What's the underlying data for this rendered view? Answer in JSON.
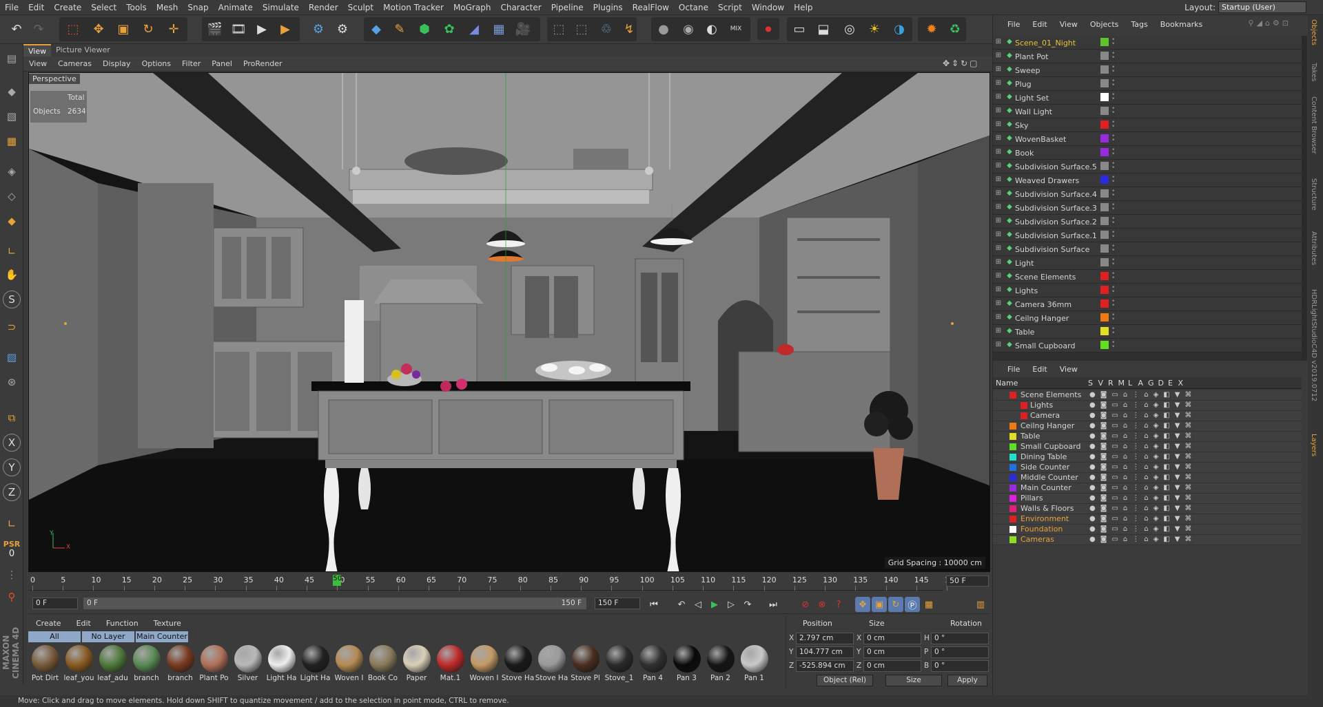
{
  "menubar": {
    "items": [
      "File",
      "Edit",
      "Create",
      "Select",
      "Tools",
      "Mesh",
      "Snap",
      "Animate",
      "Simulate",
      "Render",
      "Sculpt",
      "Motion Tracker",
      "MoGraph",
      "Character",
      "Pipeline",
      "Plugins",
      "RealFlow",
      "Octane",
      "Script",
      "Window",
      "Help"
    ],
    "layout_label": "Layout:",
    "layout_value": "Startup (User)"
  },
  "viewport": {
    "tabs": [
      "View",
      "Picture Viewer"
    ],
    "menu": [
      "View",
      "Cameras",
      "Display",
      "Options",
      "Filter",
      "Panel",
      "ProRender"
    ],
    "camera_label": "Perspective",
    "hud": {
      "total_label": "Total",
      "objects_label": "Objects",
      "objects_value": "2634"
    },
    "grid_spacing": "Grid Spacing : 10000 cm",
    "axes": {
      "y": "Y",
      "x": "X"
    }
  },
  "left_tools": {
    "psr_label": "PSR",
    "psr_value": "0",
    "x_label": "X",
    "y_label": "Y",
    "z_label": "Z",
    "s_label": "S"
  },
  "timeline": {
    "ticks": [
      "0",
      "5",
      "10",
      "15",
      "20",
      "25",
      "30",
      "35",
      "40",
      "45",
      "50",
      "55",
      "60",
      "65",
      "70",
      "75",
      "80",
      "85",
      "90",
      "95",
      "100",
      "105",
      "110",
      "115",
      "120",
      "125",
      "130",
      "135",
      "140",
      "145",
      "150"
    ],
    "current": "50",
    "end_frame": "50 F",
    "start_field": "0 F",
    "range_start": "0 F",
    "range_end": "150 F",
    "max_field": "150 F"
  },
  "materials": {
    "menu": [
      "Create",
      "Edit",
      "Function",
      "Texture"
    ],
    "filters": [
      "All",
      "No Layer",
      "Main Counter"
    ],
    "items": [
      {
        "name": "Pot Dirt",
        "color": "#7a5a3a"
      },
      {
        "name": "leaf_you",
        "color": "#8a5a22"
      },
      {
        "name": "leaf_adu",
        "color": "#4f7a3a"
      },
      {
        "name": "branch",
        "color": "#5a8a55"
      },
      {
        "name": "branch",
        "color": "#7a3a20"
      },
      {
        "name": "Plant Po",
        "color": "#b0705a"
      },
      {
        "name": "Silver",
        "color": "#b8b8b8"
      },
      {
        "name": "Light Ha",
        "color": "#eeeeee"
      },
      {
        "name": "Light Ha",
        "color": "#222222"
      },
      {
        "name": "Woven I",
        "color": "#b58a55"
      },
      {
        "name": "Book Co",
        "color": "#8a7a5a"
      },
      {
        "name": "Paper",
        "color": "#d8d0b8"
      },
      {
        "name": "Mat.1",
        "color": "#c02a2a"
      },
      {
        "name": "Woven I",
        "color": "#c49a65"
      },
      {
        "name": "Stove Ha",
        "color": "#1a1a1a"
      },
      {
        "name": "Stove Ha",
        "color": "#9a9a9a"
      },
      {
        "name": "Stove Pl",
        "color": "#4a2e20"
      },
      {
        "name": "Stove_1",
        "color": "#2a2a2a"
      },
      {
        "name": "Pan 4",
        "color": "#303030"
      },
      {
        "name": "Pan 3",
        "color": "#0a0a0a"
      },
      {
        "name": "Pan 2",
        "color": "#151515"
      },
      {
        "name": "Pan 1",
        "color": "#c8c8c8"
      }
    ]
  },
  "coords": {
    "headers": [
      "Position",
      "Size",
      "Rotation"
    ],
    "rows": [
      {
        "axis": "X",
        "pos": "2.797 cm",
        "size_axis": "X",
        "size": "0 cm",
        "rot_axis": "H",
        "rot": "0 °"
      },
      {
        "axis": "Y",
        "pos": "104.777 cm",
        "size_axis": "Y",
        "size": "0 cm",
        "rot_axis": "P",
        "rot": "0 °"
      },
      {
        "axis": "Z",
        "pos": "-525.894 cm",
        "size_axis": "Z",
        "size": "0 cm",
        "rot_axis": "B",
        "rot": "0 °"
      }
    ],
    "mode": "Object (Rel)",
    "size_mode": "Size",
    "apply": "Apply"
  },
  "status": "Move: Click and drag to move elements. Hold down SHIFT to quantize movement / add to the selection in point mode, CTRL to remove.",
  "objects": {
    "menu": [
      "File",
      "Edit",
      "View",
      "Objects",
      "Tags",
      "Bookmarks"
    ],
    "rows": [
      {
        "name": "Scene_01_Night",
        "color": "#5ec62a",
        "highlight": true
      },
      {
        "name": "Plant Pot",
        "color": "#888"
      },
      {
        "name": "Sweep",
        "color": "#888"
      },
      {
        "name": "Plug",
        "color": "#888"
      },
      {
        "name": "Light Set",
        "color": "#ffffff"
      },
      {
        "name": "Wall Light",
        "color": "#888"
      },
      {
        "name": "Sky",
        "color": "#e02020"
      },
      {
        "name": "WovenBasket",
        "color": "#9a2ae0"
      },
      {
        "name": "Book",
        "color": "#9a2ae0"
      },
      {
        "name": "Subdivision Surface.5",
        "color": "#888"
      },
      {
        "name": "Weaved Drawers",
        "color": "#2a2ae0"
      },
      {
        "name": "Subdivision Surface.4",
        "color": "#888"
      },
      {
        "name": "Subdivision Surface.3",
        "color": "#888"
      },
      {
        "name": "Subdivision Surface.2",
        "color": "#888"
      },
      {
        "name": "Subdivision Surface.1",
        "color": "#888"
      },
      {
        "name": "Subdivision Surface",
        "color": "#888"
      },
      {
        "name": "Light",
        "color": "#888"
      },
      {
        "name": "Scene Elements",
        "color": "#e02020"
      },
      {
        "name": "Lights",
        "color": "#e02020"
      },
      {
        "name": "Camera 36mm",
        "color": "#e02020"
      },
      {
        "name": "Ceilng Hanger",
        "color": "#f07a10"
      },
      {
        "name": "Table",
        "color": "#e0e020"
      },
      {
        "name": "Small Cupboard",
        "color": "#60e020"
      }
    ]
  },
  "layers": {
    "menu": [
      "File",
      "Edit",
      "View"
    ],
    "header": {
      "name": "Name",
      "cols": [
        "S",
        "V",
        "R",
        "M",
        "L",
        "A",
        "G",
        "D",
        "E",
        "X"
      ]
    },
    "rows": [
      {
        "name": "Scene Elements",
        "color": "#e02020"
      },
      {
        "name": "Lights",
        "color": "#e02020"
      },
      {
        "name": "Camera",
        "color": "#e02020"
      },
      {
        "name": "Ceilng Hanger",
        "color": "#f07a10"
      },
      {
        "name": "Table",
        "color": "#e0e020"
      },
      {
        "name": "Small Cupboard",
        "color": "#60e020"
      },
      {
        "name": "Dining Table",
        "color": "#20e0d0"
      },
      {
        "name": "Side Counter",
        "color": "#2070e0"
      },
      {
        "name": "Middle Counter",
        "color": "#2a2ae0"
      },
      {
        "name": "Main Counter",
        "color": "#9a2ae0"
      },
      {
        "name": "Pillars",
        "color": "#e020e0"
      },
      {
        "name": "Walls & Floors",
        "color": "#e0207a"
      },
      {
        "name": "Environment",
        "color": "#e02020"
      },
      {
        "name": "Foundation",
        "color": "#ffffff"
      },
      {
        "name": "Cameras",
        "color": "#8ae020"
      }
    ]
  },
  "side_tabs": [
    "Objects",
    "Takes",
    "Content Browser",
    "Structure",
    "Attributes",
    "HDRLightStudioC4D v2019.0712",
    "Layers"
  ],
  "brand": "MAXON CINEMA 4D"
}
